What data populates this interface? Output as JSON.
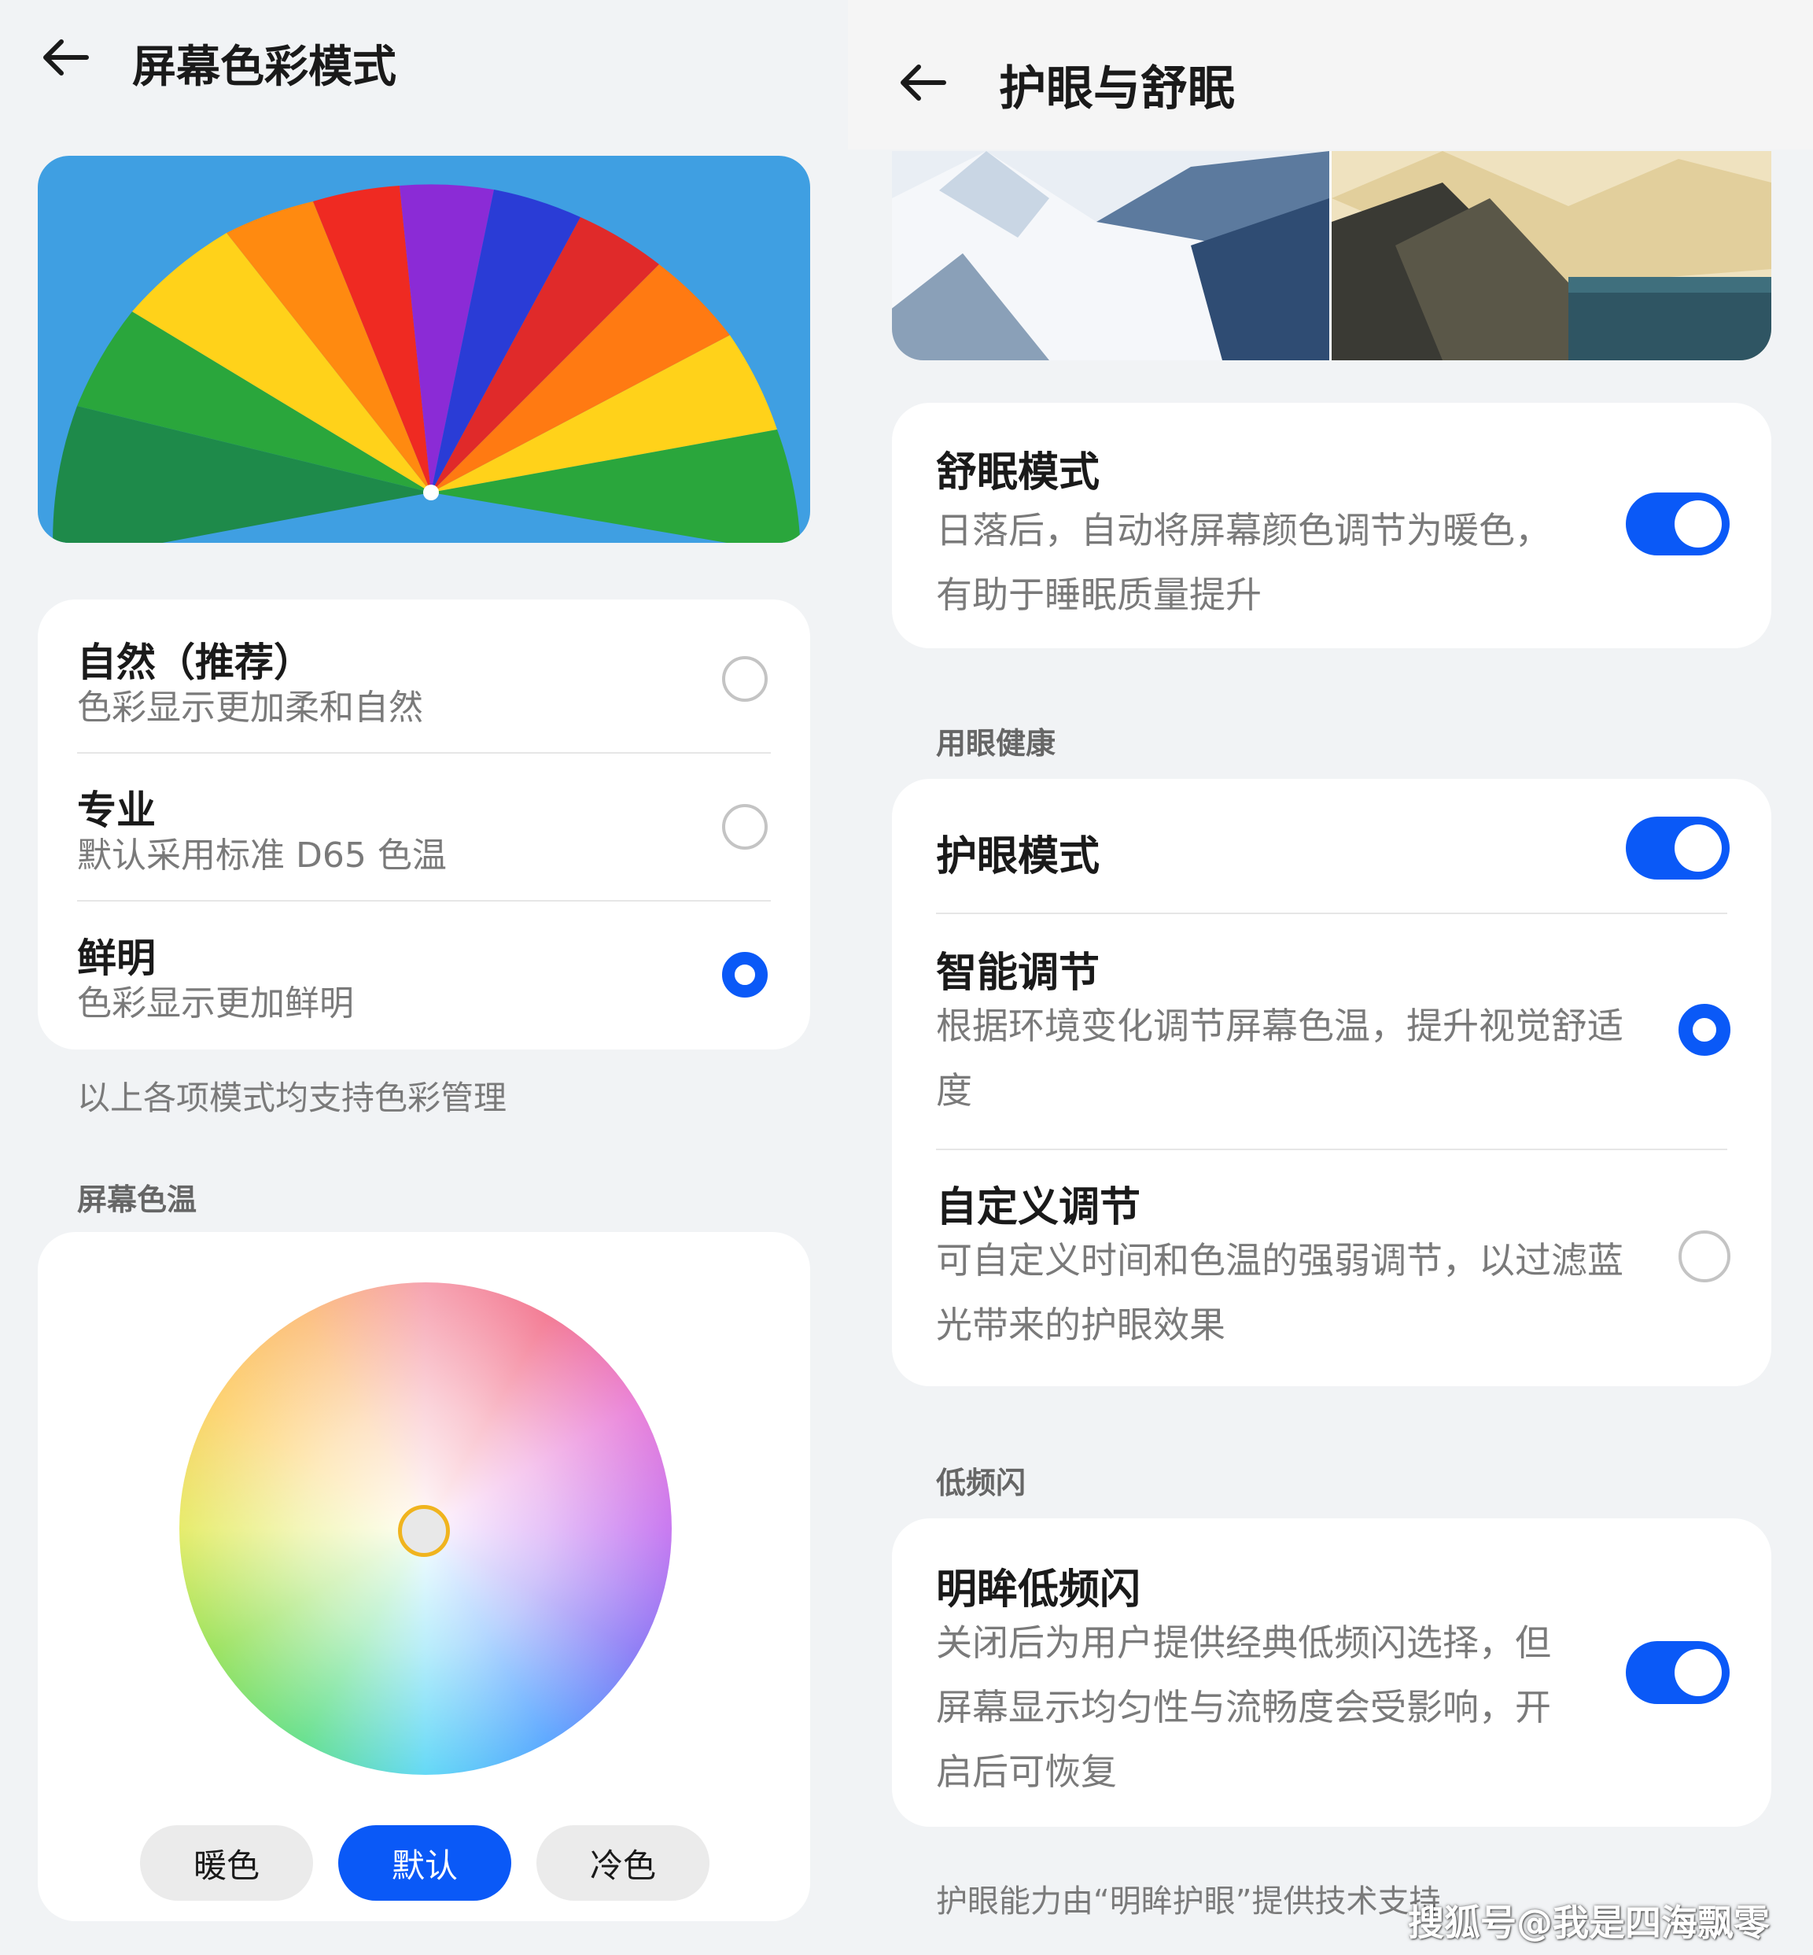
{
  "left": {
    "title": "屏幕色彩模式",
    "modes": [
      {
        "label": "自然（推荐）",
        "desc": "色彩显示更加柔和自然",
        "selected": false
      },
      {
        "label": "专业",
        "desc": "默认采用标准 D65 色温",
        "selected": false
      },
      {
        "label": "鲜明",
        "desc": "色彩显示更加鲜明",
        "selected": true
      }
    ],
    "note": "以上各项模式均支持色彩管理",
    "temp_section": "屏幕色温",
    "temp_buttons": {
      "warm": "暖色",
      "default": "默认",
      "cool": "冷色"
    },
    "temp_selected": "默认"
  },
  "right": {
    "title": "护眼与舒眠",
    "sleep": {
      "label": "舒眠模式",
      "desc_line1": "日落后，自动将屏幕颜色调节为暖色，",
      "desc_line2": "有助于睡眠质量提升",
      "on": true
    },
    "eye_section": "用眼健康",
    "eye_mode": {
      "label": "护眼模式",
      "on": true
    },
    "smart": {
      "label": "智能调节",
      "desc_line1": "根据环境变化调节屏幕色温，提升视觉舒适",
      "desc_line2": "度",
      "selected": true
    },
    "custom": {
      "label": "自定义调节",
      "desc_line1": "可自定义时间和色温的强弱调节，以过滤蓝",
      "desc_line2": "光带来的护眼效果",
      "selected": false
    },
    "flicker_section": "低频闪",
    "flicker": {
      "label": "明眸低频闪",
      "desc_line1": "关闭后为用户提供经典低频闪选择，但",
      "desc_line2": "屏幕显示均匀性与流畅度会受影响，开",
      "desc_line3": "启后可恢复",
      "on": true
    },
    "footer": "护眼能力由“明眸护眼”提供技术支持"
  },
  "watermark": "搜狐号@我是四海飘零",
  "colors": {
    "accent": "#0a59f7",
    "background": "#f1f3f5",
    "card": "#ffffff"
  },
  "icons": {
    "back": "arrow-left-icon"
  }
}
